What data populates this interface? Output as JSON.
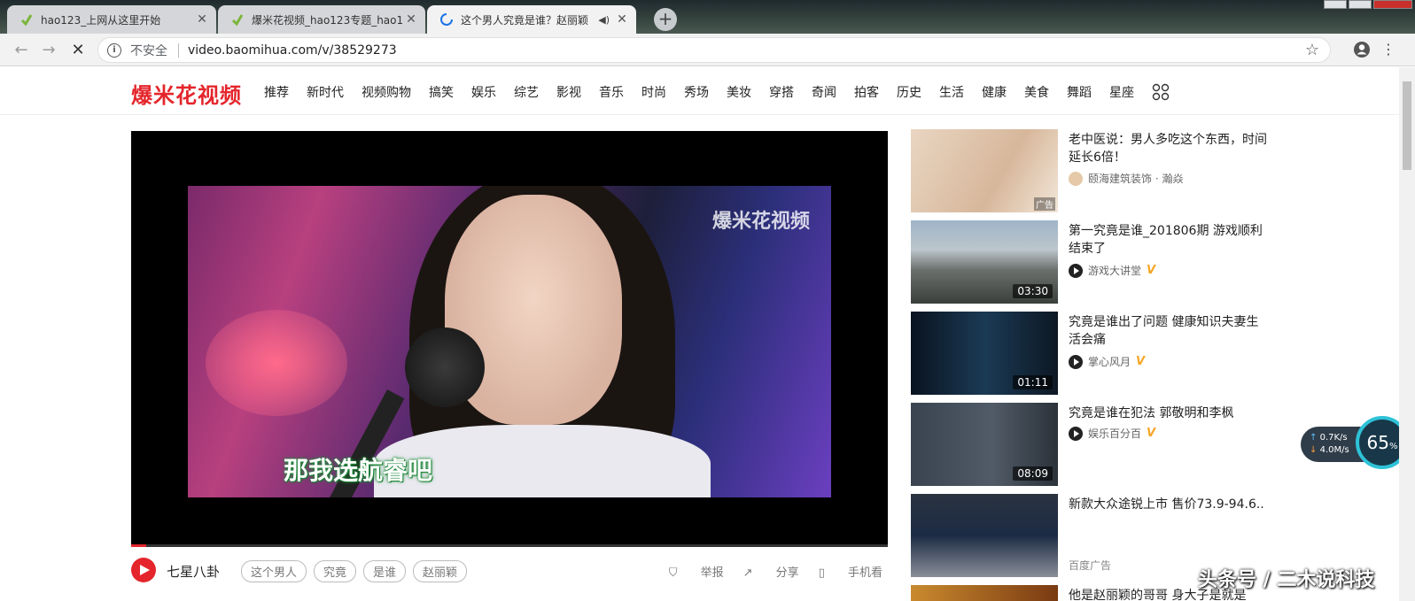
{
  "browser": {
    "tabs": [
      {
        "title": "hao123_上网从这里开始",
        "favicon": "hao123-icon"
      },
      {
        "title": "爆米花视频_hao123专题_hao12",
        "favicon": "hao123-icon"
      },
      {
        "title": "这个男人究竟是谁？赵丽颖",
        "favicon": "loading-spinner-icon"
      }
    ],
    "new_tab_label": "+",
    "security_label": "不安全",
    "url": "video.baomihua.com/v/38529273"
  },
  "site": {
    "logo": "爆米花视频",
    "nav": [
      "推荐",
      "新时代",
      "视频购物",
      "搞笑",
      "娱乐",
      "综艺",
      "影视",
      "音乐",
      "时尚",
      "秀场",
      "美妆",
      "穿搭",
      "奇闻",
      "拍客",
      "历史",
      "生活",
      "健康",
      "美食",
      "舞蹈",
      "星座"
    ]
  },
  "player": {
    "watermark": "爆米花视频",
    "subtitle": "那我选航睿吧",
    "progress": 0.02
  },
  "video_info": {
    "channel": "七星八卦",
    "tags": [
      "这个男人",
      "究竟",
      "是谁",
      "赵丽颖"
    ],
    "actions": {
      "report": "举报",
      "share": "分享",
      "mobile": "手机看"
    }
  },
  "recommendations": [
    {
      "title": "老中医说：男人多吃这个东西，时间延长6倍！",
      "source": "颐海建筑装饰 · 瀚焱",
      "ad_tag": "广告",
      "duration": ""
    },
    {
      "title": "第一究竟是谁_201806期 游戏顺利结束了",
      "source": "游戏大讲堂",
      "verified": "V",
      "duration": "03:30"
    },
    {
      "title": "究竟是谁出了问题 健康知识夫妻生活会痛",
      "source": "掌心风月",
      "verified": "V",
      "duration": "01:11"
    },
    {
      "title": "究竟是谁在犯法 郭敬明和李枫",
      "source": "娱乐百分百",
      "verified": "V",
      "duration": "08:09"
    },
    {
      "title": "新款大众途锐上市 售价73.9-94.6..",
      "source": "百度广告",
      "duration": ""
    },
    {
      "title": "他是赵丽颖的哥哥 身大子是就是",
      "source": "",
      "duration": ""
    }
  ],
  "speed_widget": {
    "upload": "0.7K/s",
    "download": "4.0M/s",
    "percent": "65",
    "percent_sign": "%"
  },
  "watermark": "头条号 / 二木说科技"
}
